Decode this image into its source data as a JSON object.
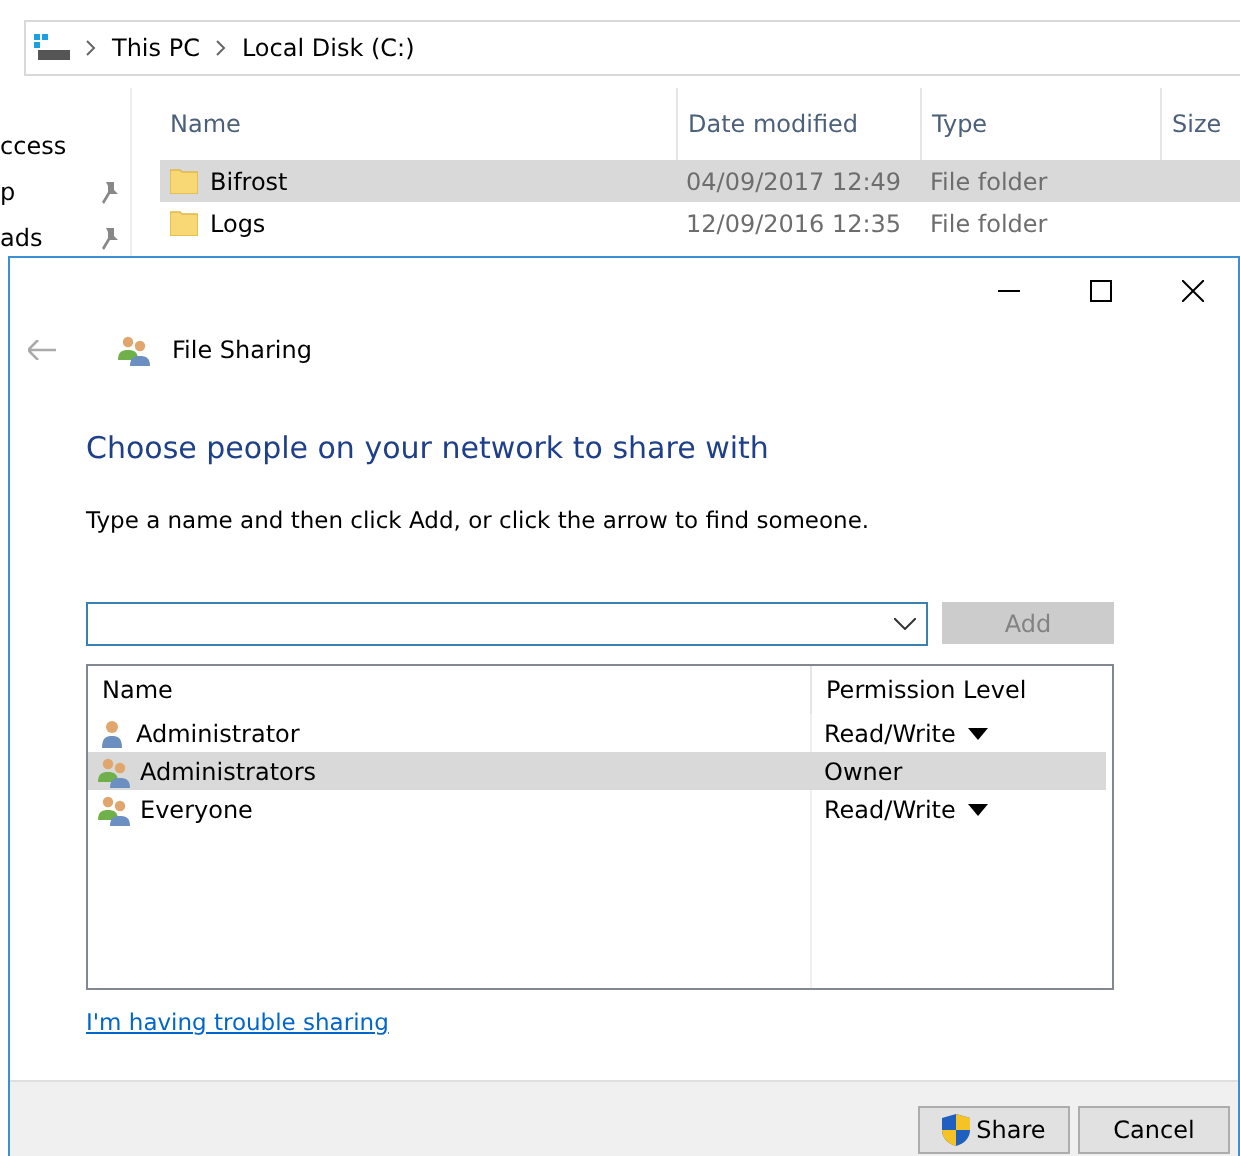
{
  "explorer": {
    "breadcrumb": [
      "This PC",
      "Local Disk (C:)"
    ],
    "sidebar": [
      {
        "label": "ccess",
        "pinned": false
      },
      {
        "label": "p",
        "pinned": true
      },
      {
        "label": "ads",
        "pinned": true
      }
    ],
    "columns": [
      "Name",
      "Date modified",
      "Type",
      "Size"
    ],
    "rows": [
      {
        "name": "Bifrost",
        "date": "04/09/2017 12:49",
        "type": "File folder",
        "selected": true
      },
      {
        "name": "Logs",
        "date": "12/09/2016 12:35",
        "type": "File folder",
        "selected": false
      }
    ]
  },
  "dialog": {
    "title": "File Sharing",
    "heading": "Choose people on your network to share with",
    "instruction": "Type a name and then click Add, or click the arrow to find someone.",
    "add_button": {
      "label": "Add",
      "disabled": true
    },
    "columns": [
      "Name",
      "Permission Level"
    ],
    "people": [
      {
        "name": "Administrator",
        "kind": "user",
        "permission": "Read/Write",
        "has_menu": true,
        "selected": false
      },
      {
        "name": "Administrators",
        "kind": "group",
        "permission": "Owner",
        "has_menu": false,
        "selected": true
      },
      {
        "name": "Everyone",
        "kind": "group",
        "permission": "Read/Write",
        "has_menu": true,
        "selected": false
      }
    ],
    "help_link": "I'm having trouble sharing",
    "buttons": [
      {
        "label": "Share",
        "shield": true
      },
      {
        "label": "Cancel",
        "shield": false
      }
    ]
  }
}
